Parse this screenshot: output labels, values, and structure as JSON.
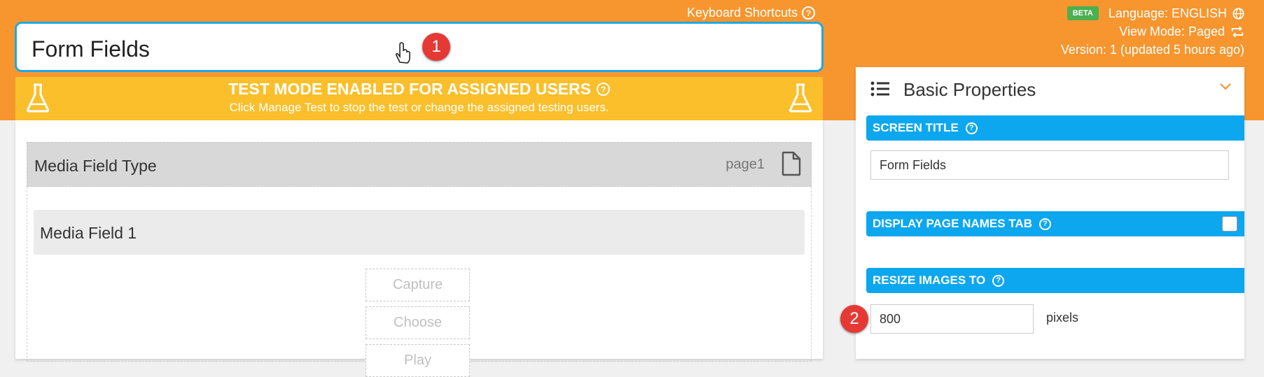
{
  "header": {
    "keyboard_shortcuts": "Keyboard Shortcuts",
    "beta_badge": "BETA",
    "language": "Language: ENGLISH",
    "view_mode": "View Mode: Paged",
    "version": "Version: 1 (updated 5 hours ago)"
  },
  "form_title": "Form Fields",
  "annotations": {
    "badge_1": "1",
    "badge_2": "2"
  },
  "test_banner": {
    "title": "TEST MODE ENABLED FOR ASSIGNED USERS",
    "subtitle": "Click Manage Test to stop the test or change the assigned testing users."
  },
  "form": {
    "page_title": "Media Field Type",
    "page_name": "page1",
    "field_label": "Media Field 1",
    "buttons": {
      "capture": "Capture",
      "choose": "Choose",
      "play": "Play"
    }
  },
  "properties": {
    "title": "Basic Properties",
    "screen_title_label": "SCREEN TITLE",
    "screen_title_value": "Form Fields",
    "display_page_names_label": "DISPLAY PAGE NAMES TAB",
    "display_page_names_checked": false,
    "resize_images_label": "RESIZE IMAGES TO",
    "resize_value": "800",
    "resize_unit": "pixels"
  },
  "colors": {
    "header_orange": "#f7962e",
    "banner_yellow": "#fbbf2c",
    "section_blue": "#0ca7ef",
    "title_border_blue": "#1fa8e6",
    "badge_red": "#e53935",
    "beta_green": "#4caf50"
  },
  "icons": [
    "help-circle-icon",
    "globe-icon",
    "repeat-icon",
    "flask-icon",
    "document-icon",
    "list-icon",
    "chevron-down-icon",
    "hand-cursor-icon"
  ]
}
